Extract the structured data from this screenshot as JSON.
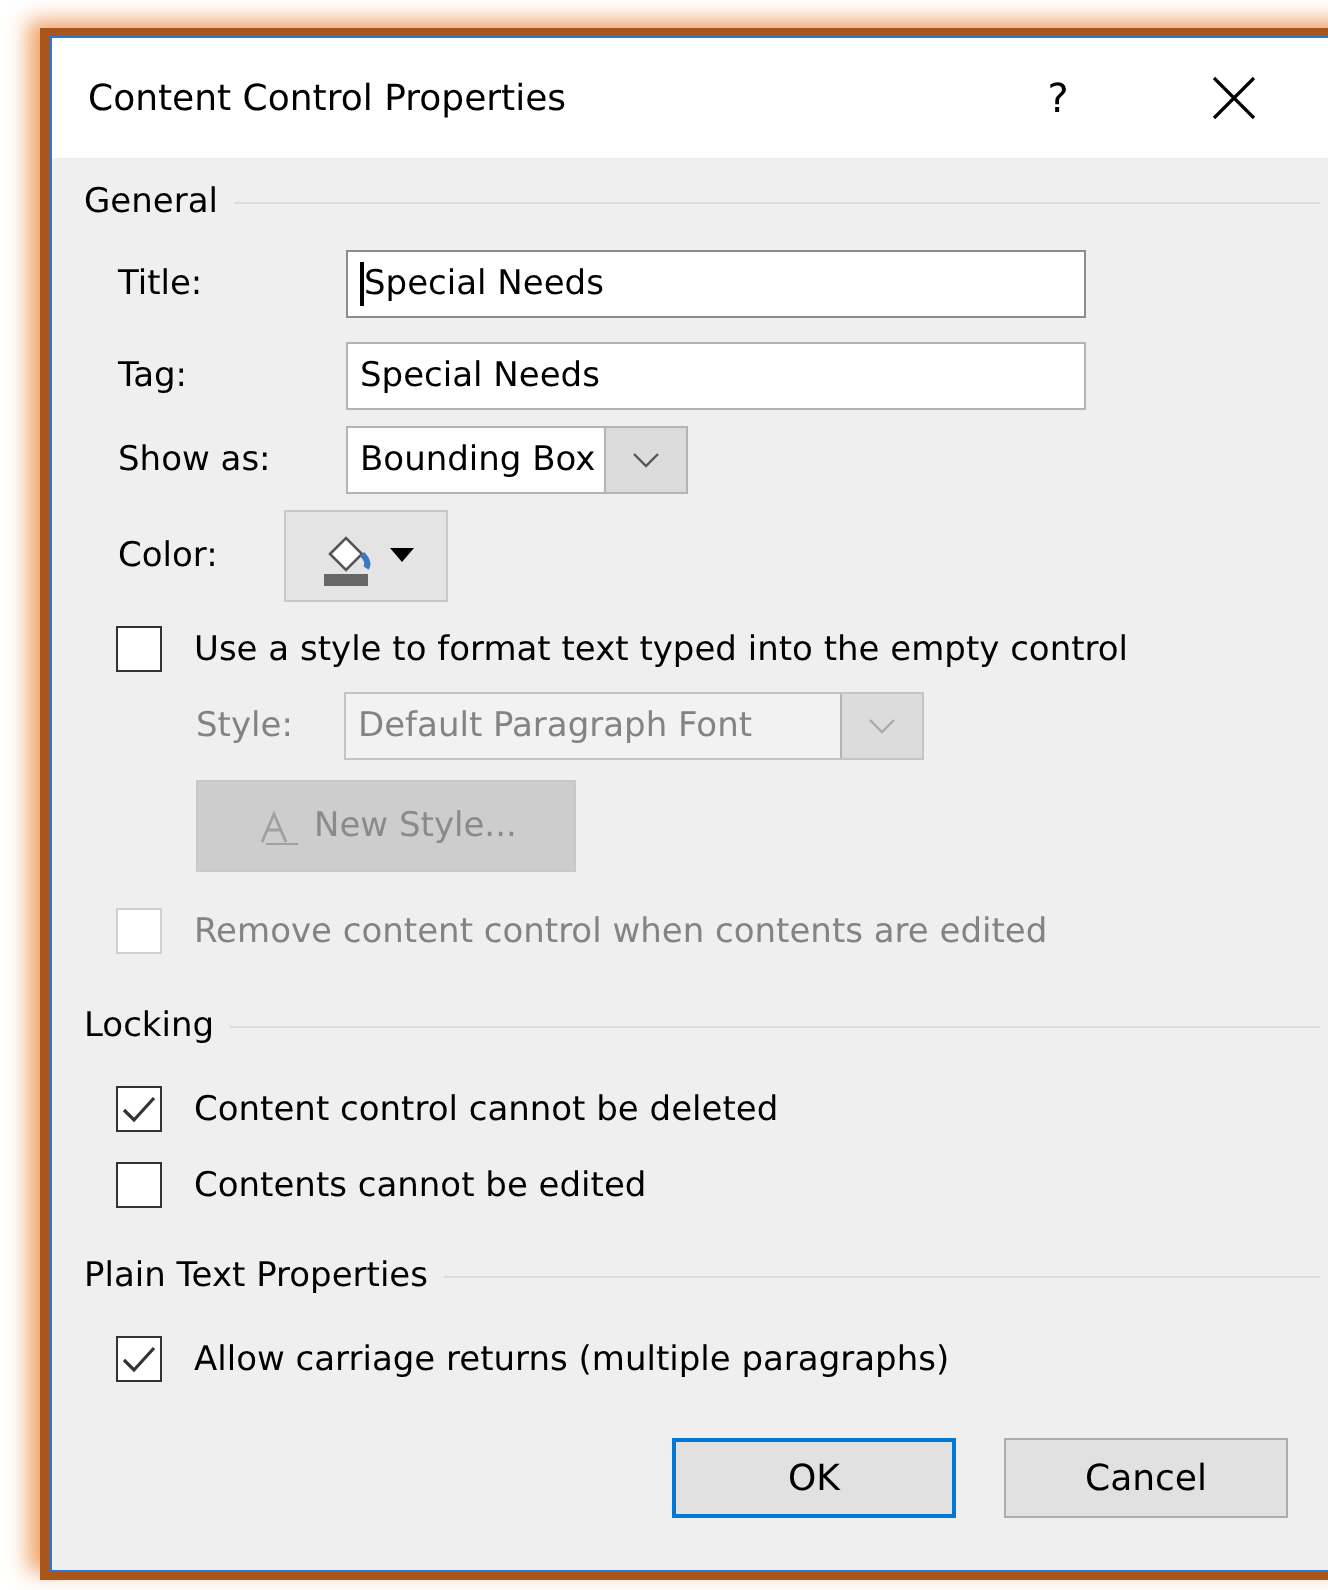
{
  "window": {
    "title": "Content Control Properties",
    "help": "?"
  },
  "general": {
    "header": "General",
    "fields": [
      {
        "label": "Title:",
        "value": "Special Needs",
        "focused": true
      },
      {
        "label": "Tag:",
        "value": "Special Needs",
        "focused": false
      }
    ],
    "show_as": {
      "label": "Show as:",
      "value": "Bounding Box"
    },
    "color": {
      "label": "Color:"
    },
    "use_style": {
      "label": "Use a style to format text typed into the empty control",
      "checked": false,
      "disabled": false
    },
    "style": {
      "label": "Style:",
      "value": "Default Paragraph Font",
      "disabled": true
    },
    "new_style_button": {
      "label": "New Style...",
      "disabled": true
    },
    "remove": {
      "label": "Remove content control when contents are edited",
      "checked": false,
      "disabled": true
    }
  },
  "locking": {
    "header": "Locking",
    "options": [
      {
        "label": "Content control cannot be deleted",
        "checked": true,
        "disabled": false
      },
      {
        "label": "Contents cannot be edited",
        "checked": false,
        "disabled": false
      }
    ]
  },
  "plain_text": {
    "header": "Plain Text Properties",
    "options": [
      {
        "label": "Allow carriage returns (multiple paragraphs)",
        "checked": true,
        "disabled": false
      }
    ]
  },
  "buttons": [
    {
      "label": "OK",
      "default": true
    },
    {
      "label": "Cancel",
      "default": false
    }
  ]
}
